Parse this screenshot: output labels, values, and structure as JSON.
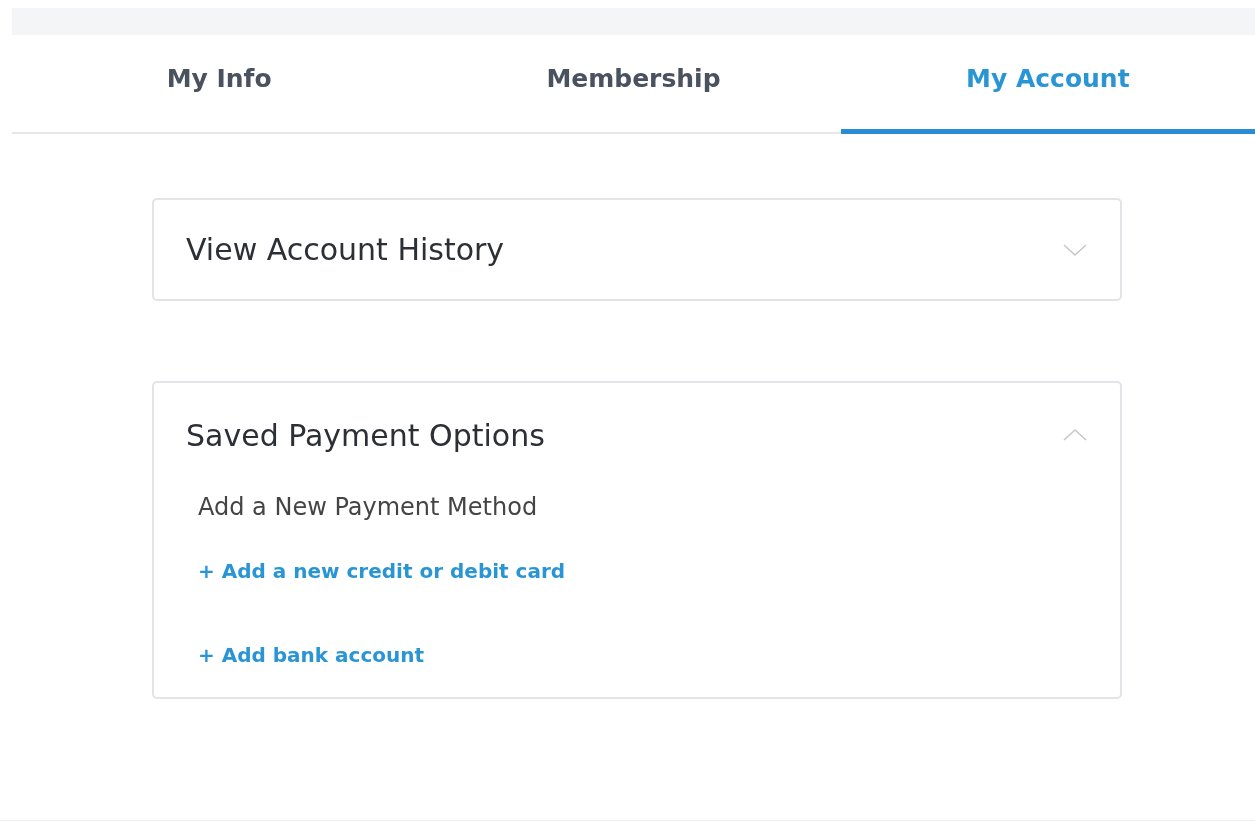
{
  "tabs": [
    {
      "label": "My Info",
      "selected": false
    },
    {
      "label": "Membership",
      "selected": false
    },
    {
      "label": "My Account",
      "selected": true
    }
  ],
  "panels": [
    {
      "title": "View Account History",
      "expanded": false
    },
    {
      "title": "Saved Payment Options",
      "expanded": true,
      "section_title": "Add a New Payment Method",
      "links": [
        "+ Add a new credit or debit card",
        "+ Add bank account"
      ]
    }
  ]
}
